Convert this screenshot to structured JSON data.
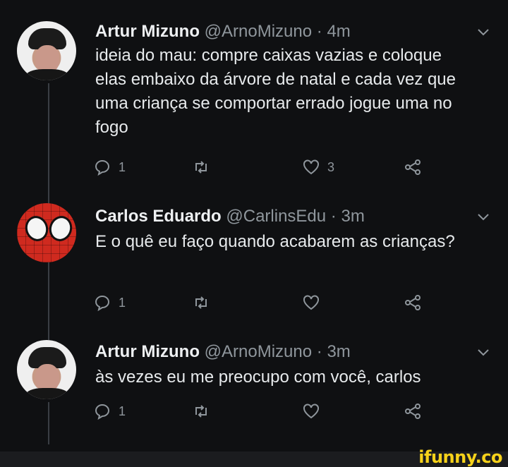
{
  "tweets": [
    {
      "name": "Artur Mizuno",
      "handle": "@ArnoMizuno",
      "separator": "·",
      "time": "4m",
      "text": "ideia do mau: compre caixas vazias e coloque elas embaixo da árvore de natal e cada vez que uma criança se comportar errado jogue uma no fogo",
      "reply_count": "1",
      "like_count": "3"
    },
    {
      "name": "Carlos Eduardo",
      "handle": "@CarlinsEdu",
      "separator": "·",
      "time": "3m",
      "text": "E o quê eu faço quando acabarem as crianças?",
      "reply_count": "1",
      "like_count": ""
    },
    {
      "name": "Artur Mizuno",
      "handle": "@ArnoMizuno",
      "separator": "·",
      "time": "3m",
      "text": "às vezes eu me preocupo com você, carlos",
      "reply_count": "1",
      "like_count": ""
    }
  ],
  "watermark": "ifunny.co",
  "colors": {
    "background": "#0f1012",
    "secondary_text": "#8f969c",
    "watermark": "#f7d21a"
  }
}
